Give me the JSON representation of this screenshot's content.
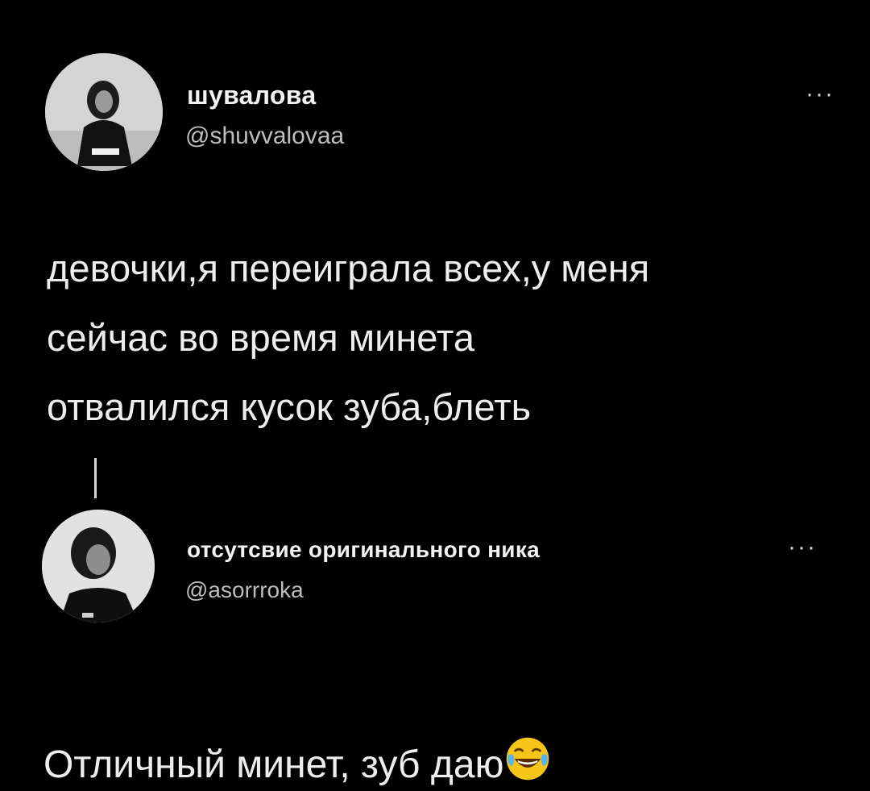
{
  "tweet": {
    "display_name": "шувалова",
    "handle": "@shuvvalovaa",
    "text": "девочки,я переиграла всех,у меня\nсейчас во время минета\nотвалился кусок зуба,блеть",
    "more_icon": "more-horizontal-icon"
  },
  "reply": {
    "display_name": "отсутсвие оригинального ника",
    "handle": "@asorrroka",
    "text_before_emoji": "Отличный минет, зуб даю",
    "emoji": "face-with-tears-of-joy",
    "more_icon": "more-horizontal-icon"
  },
  "colors": {
    "background": "#000000",
    "text": "#ededed",
    "handle": "#bdbdbd"
  }
}
